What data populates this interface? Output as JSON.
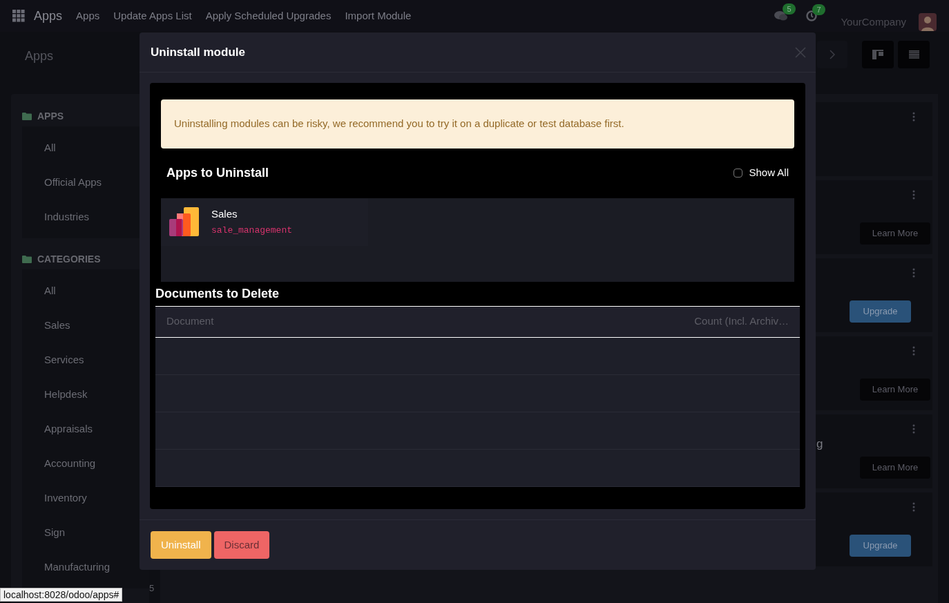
{
  "navbar": {
    "app_name": "Apps",
    "menu": [
      "Apps",
      "Update Apps List",
      "Apply Scheduled Upgrades",
      "Import Module"
    ],
    "chat_count": "5",
    "activity_count": "7",
    "company": "YourCompany"
  },
  "breadcrumb": "Apps",
  "sidebar": [
    {
      "title": "APPS",
      "items": [
        "All",
        "Official Apps",
        "Industries"
      ]
    },
    {
      "title": "CATEGORIES",
      "items": [
        "All",
        "Sales",
        "Services",
        "Helpdesk",
        "Appraisals",
        "Accounting",
        "Inventory",
        "Sign",
        "Manufacturing"
      ]
    }
  ],
  "cards": [
    {
      "menu_icon": true
    },
    {
      "menu_icon": true,
      "button": {
        "label": "Learn More",
        "kind": "learn"
      }
    },
    {
      "menu_icon": true,
      "button": {
        "label": "Upgrade",
        "kind": "upgrade"
      }
    },
    {
      "menu_icon": true,
      "button": {
        "label": "Learn More",
        "kind": "learn"
      }
    },
    {
      "menu_icon": true,
      "title_fragment": "g",
      "button": {
        "label": "Learn More",
        "kind": "learn"
      }
    },
    {
      "menu_icon": true,
      "button": {
        "label": "Upgrade",
        "kind": "upgrade"
      }
    }
  ],
  "pager_fragment": "5",
  "status_url": "localhost:8028/odoo/apps#",
  "dialog": {
    "title": "Uninstall module",
    "alert": "Uninstalling modules can be risky, we recommend you to try it on a duplicate or test database first.",
    "apps_heading": "Apps to Uninstall",
    "show_all": {
      "label": "Show All",
      "checked": false
    },
    "apps": [
      {
        "name": "Sales",
        "technical_name": "sale_management"
      }
    ],
    "documents_heading": "Documents to Delete",
    "columns": [
      "Document",
      "Count (Incl. Archiv…"
    ],
    "buttons": [
      {
        "label": "Uninstall",
        "kind": "primary"
      },
      {
        "label": "Discard",
        "kind": "danger"
      }
    ]
  }
}
